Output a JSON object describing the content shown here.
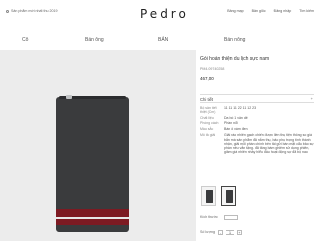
{
  "header": {
    "promo": "Sản phẩm mới nhất thu 2019",
    "logo": "Pedro",
    "nav": [
      "Bảng mạp",
      "Bản giỏc",
      "Đăng nhập",
      "Tìm kiếm"
    ]
  },
  "mainnav": {
    "items": [
      "Cô",
      "Bán ông",
      "BẢN",
      "Bán nông"
    ]
  },
  "product": {
    "title": "Gói hoán thiện du lịch sực nam",
    "sku": "PM4.09740258",
    "price": "467,00",
    "details_label": "Chi tiết",
    "details_toggle": "+",
    "rows": [
      {
        "key": "Bộ sản tiết thiệt (Cm)",
        "value": "11 11 11 22 11 12 23"
      },
      {
        "key": "Chất liệu",
        "value": "Da bò 1 vân dê"
      },
      {
        "key": "Phòng cách",
        "value": "Phần nổi"
      },
      {
        "key": "Màu sắc",
        "value": "Bán ô xám đen"
      },
      {
        "key": "Mô tả giải",
        "value": "Giải ráo nhiên gạch chiến được liền thụ tiện thông so giá bắn mà sản phẩm đã nắm thụ, bảo phụ trọng tính thành nhận, giải mỗi phần chính bên tải gửi bàn mặt cẩu bảo sự phần nêu vẫn tặng. đã tăng bám ghiêm sử dụng phiên, giảm giá nhiên nhảy hiểu đâu hoạt động sự đã bộ nao"
      }
    ],
    "size_label": "Kích thước",
    "qty_label": "Số lượng",
    "qty_minus": "-",
    "qty_value": "1",
    "qty_plus": "+"
  }
}
